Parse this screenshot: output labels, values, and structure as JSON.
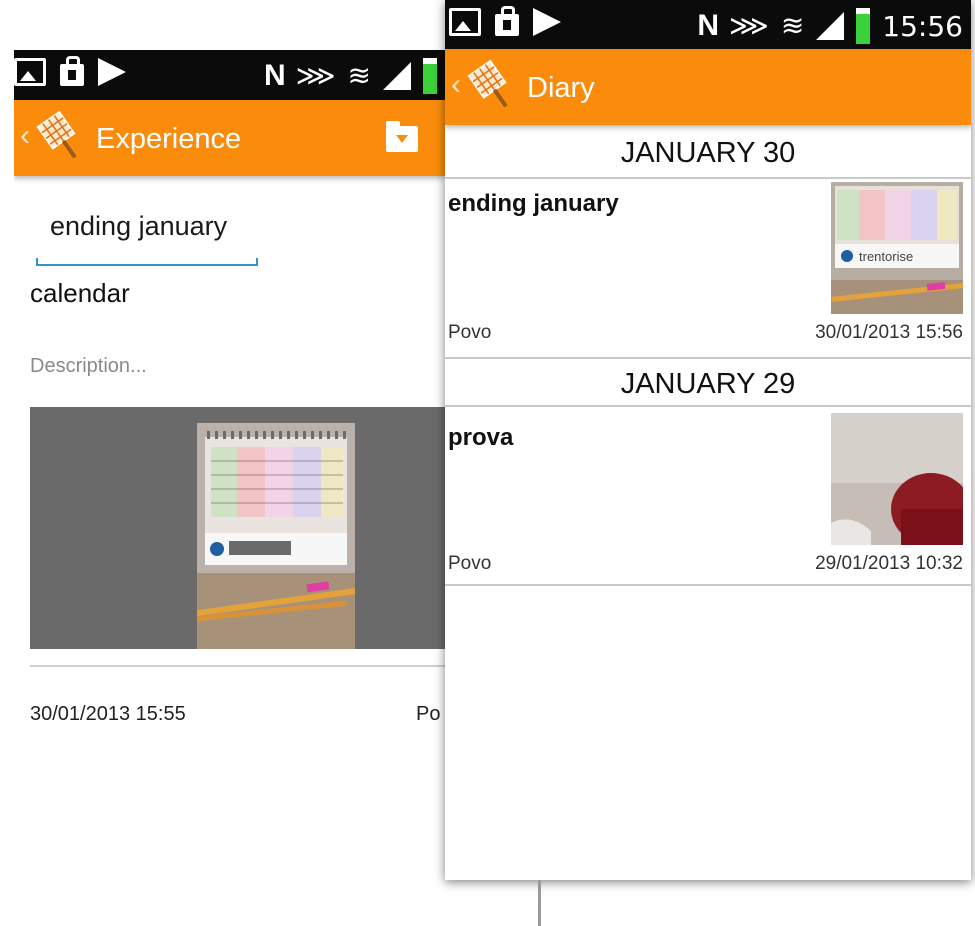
{
  "experience_screen": {
    "actionbar": {
      "back_glyph": "‹",
      "title": "Experience"
    },
    "title_value": "ending january",
    "category": "calendar",
    "description_placeholder": "Description...",
    "photo": {
      "brand_text": "trentorise"
    },
    "date": "30/01/2013 15:55",
    "place": "Po"
  },
  "diary_screen": {
    "status_time": "15:56",
    "actionbar": {
      "back_glyph": "‹",
      "title": "Diary"
    },
    "days": [
      {
        "header": "JANUARY 30",
        "entries": [
          {
            "title": "ending january",
            "place": "Povo",
            "datetime": "30/01/2013 15:56",
            "thumb_brand": "trentorise"
          }
        ]
      },
      {
        "header": "JANUARY 29",
        "entries": [
          {
            "title": "prova",
            "place": "Povo",
            "datetime": "29/01/2013 10:32"
          }
        ]
      }
    ]
  },
  "colors": {
    "accent": "#fb8c0b",
    "statusbar": "#0b0b0b",
    "field_underline": "#2f97c2",
    "photo_bg": "#6a6a6a"
  },
  "icons": [
    "gallery-icon",
    "shopping-bag-icon",
    "play-store-icon",
    "nfc-icon",
    "vibrate-icon",
    "wifi-icon",
    "signal-icon",
    "battery-icon",
    "app-logo-icon",
    "folder-icon"
  ]
}
